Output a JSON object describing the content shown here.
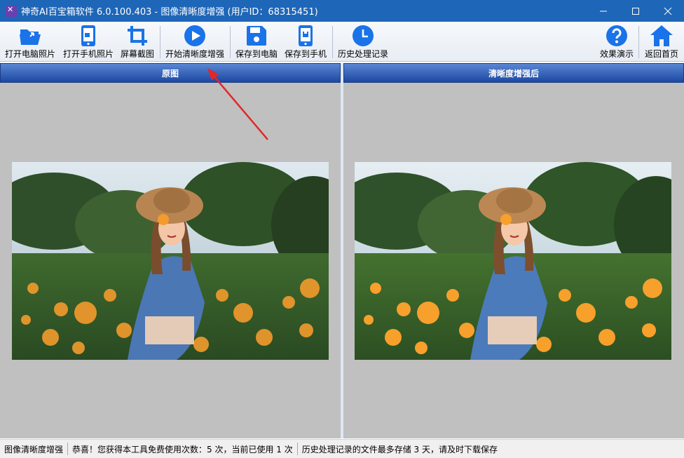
{
  "window": {
    "title": "神奇AI百宝箱软件 6.0.100.403 - 图像清晰度增强 (用户ID：68315451)"
  },
  "toolbar": {
    "open_pc_photo": "打开电脑照片",
    "open_phone_photo": "打开手机照片",
    "screenshot": "屏幕截图",
    "start_enhance": "开始清晰度增强",
    "save_to_pc": "保存到电脑",
    "save_to_phone": "保存到手机",
    "history": "历史处理记录",
    "demo": "效果演示",
    "home": "返回首页"
  },
  "panels": {
    "original_title": "原图",
    "enhanced_title": "清晰度增强后"
  },
  "statusbar": {
    "module": "图像清晰度增强",
    "usage": "恭喜！您获得本工具免费使用次数：5 次，当前已使用 1 次",
    "notice": "历史处理记录的文件最多存储 3 天，请及时下载保存"
  },
  "colors": {
    "titlebar": "#1e66b8",
    "icon_blue": "#1a73e8",
    "panel_header": "#2a56b0",
    "panel_bg": "#c0c0c0",
    "annotation_arrow": "#e32626"
  },
  "icons": {
    "open_pc_photo": "folder-open-icon",
    "open_phone_photo": "phone-icon",
    "screenshot": "crop-icon",
    "start_enhance": "play-icon",
    "save_to_pc": "floppy-icon",
    "save_to_phone": "phone-save-icon",
    "history": "clock-icon",
    "demo": "help-icon",
    "home": "home-icon"
  }
}
